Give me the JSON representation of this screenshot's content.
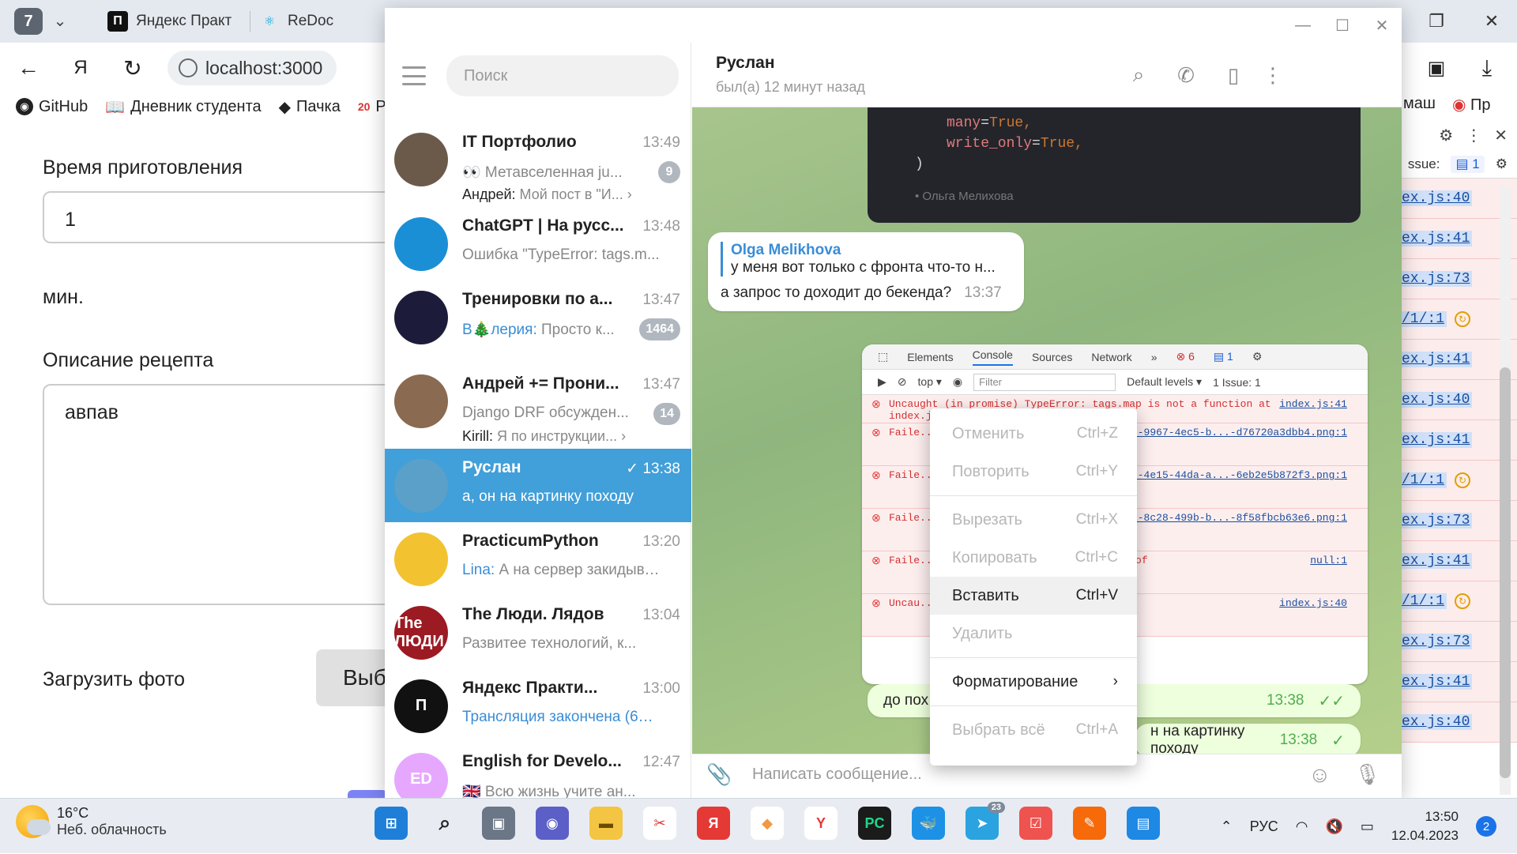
{
  "browser": {
    "tab_count": "7",
    "tabs": [
      {
        "title": "Яндекс Практ",
        "icon": "П"
      },
      {
        "title": "ReDoc",
        "icon": "⚛"
      }
    ],
    "url": "localhost:3000",
    "bookmarks": [
      {
        "label": "GitHub",
        "icon": "github-icon"
      },
      {
        "label": "Дневник студента",
        "icon": "book-icon"
      },
      {
        "label": "Пачка",
        "icon": "stack-icon"
      },
      {
        "label": "Р",
        "icon": "2035-icon"
      }
    ],
    "bookmarks_right": [
      "маш",
      "Пр"
    ]
  },
  "recipe_form": {
    "cook_time_label": "Время приготовления",
    "cook_time_value": "1",
    "cook_time_unit": "мин.",
    "description_label": "Описание рецепта",
    "description_value": "авпав",
    "photo_label": "Загрузить фото",
    "choose_button": "Выб"
  },
  "devtools": {
    "issue_label": "ssue:",
    "issue_count": "1",
    "log_links": [
      "ex.js:40",
      "ex.js:41",
      "ex.js:73",
      "/1/:1",
      "ex.js:41",
      "ex.js:40",
      "ex.js:41",
      "/1/:1",
      "ex.js:73",
      "ex.js:41",
      "/1/:1",
      "ex.js:73",
      "ex.js:41",
      "ex.js:40"
    ]
  },
  "telegram": {
    "search_placeholder": "Поиск",
    "chats": [
      {
        "name": "IT Портфолио",
        "time": "13:49",
        "sender": "",
        "preview": "👀 Метавселенная ju...",
        "sub_sender": "Андрей:",
        "sub": "Мой пост в \"И... ›",
        "badge": "9",
        "kind": "group",
        "color": "#6b5a4a"
      },
      {
        "name": "ChatGPT | На русс...",
        "time": "13:48",
        "sender": "",
        "preview": "Ошибка \"TypeError: tags.m...",
        "badge": "",
        "kind": "bot",
        "color": "#1a8fd6"
      },
      {
        "name": "Тренировки по а...",
        "time": "13:47",
        "sender": "В🎄лерия:",
        "preview": " Просто к...",
        "badge": "1464",
        "kind": "group",
        "color": "#1c1c3a"
      },
      {
        "name": "Андрей += Прони...",
        "time": "13:47",
        "sender": "",
        "preview": "Django DRF обсужден...",
        "sub_sender": "Kirill:",
        "sub": "Я по инструкции... ›",
        "badge": "14",
        "kind": "group",
        "color": "#8a6a50"
      },
      {
        "name": "Руслан",
        "time": "✓ 13:38",
        "sender": "",
        "preview": "а, он на картинку походу",
        "badge": "",
        "kind": "user",
        "color": "#5aa0c8",
        "active": true
      },
      {
        "name": "PracticumPython",
        "time": "13:20",
        "sender": "Lina:",
        "preview": " А на сервер закидыва...",
        "badge": "",
        "kind": "group",
        "color": "#f2c230"
      },
      {
        "name": "The Люди. Лядов",
        "time": "13:04",
        "sender": "",
        "preview": "Развитее технологий, к...",
        "badge": "",
        "kind": "channel",
        "color": "#9c1a22",
        "avatar_text": "The ЛЮДИ"
      },
      {
        "name": "Яндекс Практи...",
        "time": "13:00",
        "sender": "",
        "preview": "Трансляция закончена (60 ...",
        "preview_blue": true,
        "badge": "",
        "kind": "channel",
        "color": "#111111",
        "avatar_text": "П"
      },
      {
        "name": "English for Develo...",
        "time": "12:47",
        "sender": "",
        "preview": "🇬🇧 Всю жизнь учите ан...",
        "badge": "",
        "kind": "channel",
        "color": "#e6a8ff",
        "avatar_text": "ED"
      }
    ],
    "chat_header": {
      "name": "Руслан",
      "status": "был(а) 12 минут назад"
    },
    "code_lines": [
      {
        "k": "many",
        "v": "True,"
      },
      {
        "k": "write_only",
        "v": "True,"
      }
    ],
    "code_close": ")",
    "code_caption": "• Ольга Мелихова",
    "message1": {
      "reply_name": "Olga Melikhova",
      "reply_text": "у меня вот только с фронта что-то н...",
      "text": "а запрос то доходит до бекенда?",
      "time": "13:37"
    },
    "screenshot": {
      "tabs": [
        "Elements",
        "Console",
        "Sources",
        "Network",
        "»"
      ],
      "errors_count": "6",
      "msgs_count": "1",
      "context": "top ▾",
      "filter": "Filter",
      "levels": "Default levels ▾",
      "issues": "1 Issue: 1",
      "rows": [
        {
          "text": "Uncaught (in promise) TypeError: tags.map is not a function\n    at index.js:41:1",
          "src": "index.js:41"
        },
        {
          "text": "Faile...  serve  of 40",
          "src": "...bb-9967-4ec5-b...-d76720a3dbb4.png:1"
        },
        {
          "text": "Faile...  serve  of 40",
          "src": "...f9-4e15-44da-a...-6eb2e5b872f3.png:1"
        },
        {
          "text": "Faile...  serve  of 40",
          "src": "...41-8c28-499b-b...-8f58fbcb63e6.png:1"
        },
        {
          "text": "Faile...  404 (  ...sponded with a status of",
          "src": "null:1"
        },
        {
          "text": "Uncau...  ...map is not a function",
          "src": "index.js:40"
        }
      ]
    },
    "message2": {
      "text": "до пох",
      "time": "13:38"
    },
    "message3": {
      "text": "н на картинку походу",
      "time": "13:38"
    },
    "composer_placeholder": "Написать сообщение..."
  },
  "context_menu": [
    {
      "label": "Отменить",
      "shortcut": "Ctrl+Z",
      "enabled": false
    },
    {
      "label": "Повторить",
      "shortcut": "Ctrl+Y",
      "enabled": false
    },
    {
      "sep": true
    },
    {
      "label": "Вырезать",
      "shortcut": "Ctrl+X",
      "enabled": false
    },
    {
      "label": "Копировать",
      "shortcut": "Ctrl+C",
      "enabled": false
    },
    {
      "label": "Вставить",
      "shortcut": "Ctrl+V",
      "enabled": true,
      "hover": true
    },
    {
      "label": "Удалить",
      "shortcut": "",
      "enabled": false
    },
    {
      "sep": true
    },
    {
      "label": "Форматирование",
      "shortcut": "›",
      "enabled": true
    },
    {
      "sep": true
    },
    {
      "label": "Выбрать всё",
      "shortcut": "Ctrl+A",
      "enabled": false
    }
  ],
  "taskbar": {
    "temp": "16°C",
    "weather": "Неб. облачность",
    "lang": "РУС",
    "time": "13:50",
    "date": "12.04.2023",
    "notifications": "2",
    "telegram_badge": "23"
  }
}
